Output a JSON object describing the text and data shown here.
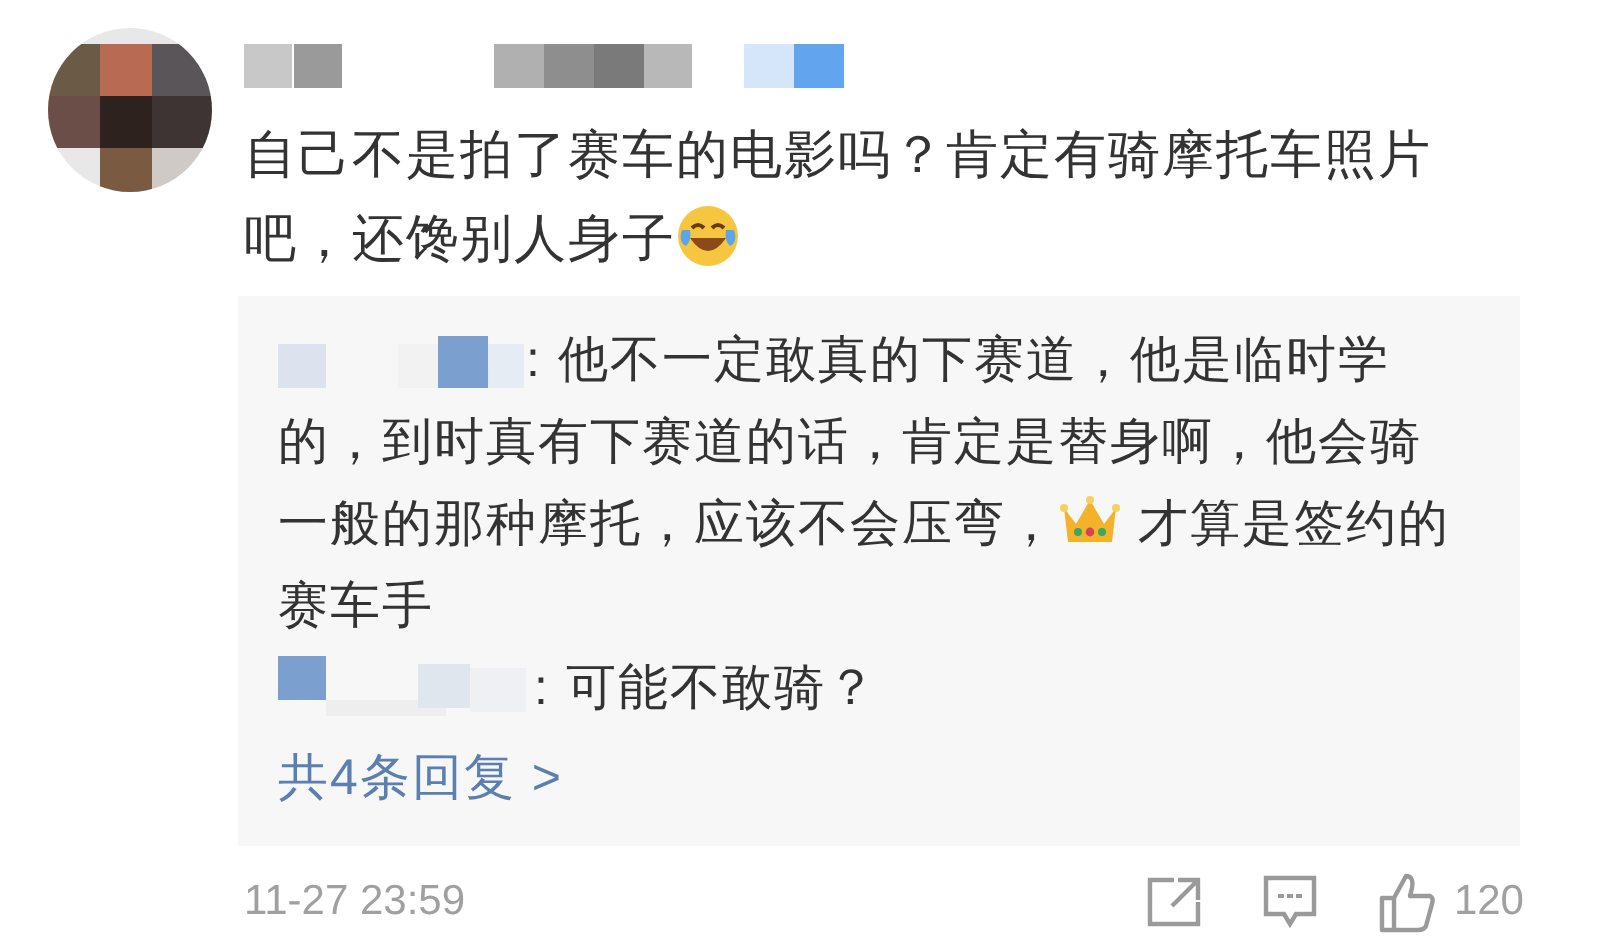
{
  "comment": {
    "segments": [
      {
        "kind": "text",
        "text": "自己不是拍了赛车的电影吗？肯定有骑摩托车照片吧，还馋别人身子"
      },
      {
        "kind": "laughing"
      }
    ],
    "replies": [
      {
        "segments": [
          {
            "kind": "text",
            "text": ": 他不一定敢真的下赛道，他是临时学的，到时真有下赛道的话，肯定是替身啊，他会骑一般的那种摩托，应该不会压弯，"
          },
          {
            "kind": "crown"
          },
          {
            "kind": "text",
            "text": " 才算是签约的赛车手"
          }
        ]
      },
      {
        "segments": [
          {
            "kind": "text",
            "text": ": 可能不敢骑？"
          }
        ]
      }
    ],
    "more_replies": "共4条回复 >",
    "time": "11-27 23:59",
    "like_count": "120"
  }
}
